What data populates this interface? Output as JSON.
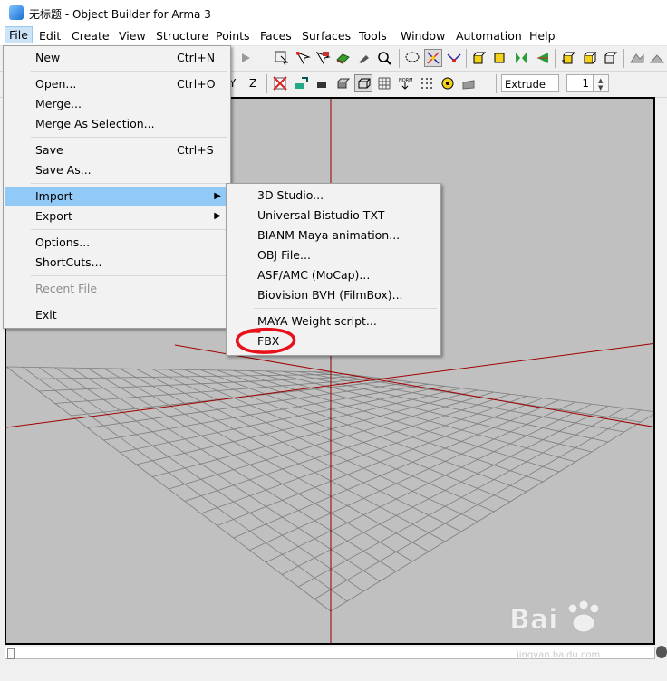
{
  "window": {
    "title": "无标题 - Object Builder for Arma 3"
  },
  "menubar": {
    "items": [
      "File",
      "Edit",
      "Create",
      "View",
      "Structure",
      "Points",
      "Faces",
      "Surfaces",
      "Tools",
      "Window",
      "Automation",
      "Help"
    ]
  },
  "toolbar2": {
    "axis_y": "Y",
    "axis_z": "Z",
    "extrude_label": "Extrude",
    "extrude_value": "1"
  },
  "file_menu": {
    "items": [
      {
        "label": "New",
        "shortcut": "Ctrl+N"
      },
      {
        "label": "Open...",
        "shortcut": "Ctrl+O"
      },
      {
        "label": "Merge..."
      },
      {
        "label": "Merge As Selection..."
      },
      {
        "label": "Save",
        "shortcut": "Ctrl+S"
      },
      {
        "label": "Save As..."
      },
      {
        "label": "Import",
        "has_submenu": true,
        "highlighted": true
      },
      {
        "label": "Export",
        "has_submenu": true
      },
      {
        "label": "Options..."
      },
      {
        "label": "ShortCuts..."
      },
      {
        "label": "Recent File",
        "disabled": true
      },
      {
        "label": "Exit"
      }
    ]
  },
  "import_menu": {
    "items": [
      {
        "label": "3D Studio..."
      },
      {
        "label": "Universal Bistudio TXT"
      },
      {
        "label": "BIANM Maya animation..."
      },
      {
        "label": "OBJ File..."
      },
      {
        "label": "ASF/AMC (MoCap)..."
      },
      {
        "label": "Biovision BVH (FilmBox)..."
      },
      {
        "label": "MAYA Weight script..."
      },
      {
        "label": "FBX",
        "annotated": true
      }
    ]
  },
  "annotation": {
    "color": "#e8101a"
  },
  "watermark": {
    "text": "jingyan.baidu.com"
  }
}
